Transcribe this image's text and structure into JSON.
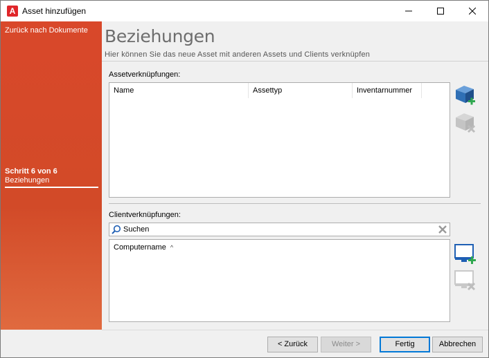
{
  "window": {
    "title": "Asset hinzufügen",
    "app_icon_glyph": "A",
    "controls": [
      "minimize-icon",
      "maximize-icon",
      "close-icon"
    ]
  },
  "sidebar": {
    "back_link": "Zurück nach Dokumente",
    "step": "Schritt 6 von 6",
    "step_name": "Beziehungen"
  },
  "header": {
    "title": "Beziehungen",
    "subtitle": "Hier können Sie das neue Asset mit anderen Assets und Clients verknüpfen"
  },
  "assets": {
    "label": "Assetverknüpfungen:",
    "columns": [
      "Name",
      "Assettyp",
      "Inventarnummer"
    ],
    "rows": [],
    "add_icon": "add-asset-icon",
    "remove_icon": "remove-asset-icon"
  },
  "clients": {
    "label": "Clientverknüpfungen:",
    "search_text": "Suchen",
    "column": "Computername",
    "sort_indicator": "^",
    "rows": [],
    "add_icon": "add-client-icon",
    "remove_icon": "remove-client-icon"
  },
  "buttons": {
    "back": "< Zurück",
    "next": "Weiter >",
    "finish": "Fertig",
    "cancel": "Abbrechen"
  },
  "colors": {
    "sidebar": "#d9482a",
    "accent_blue": "#0078d7",
    "add_green": "#2fa84f"
  }
}
